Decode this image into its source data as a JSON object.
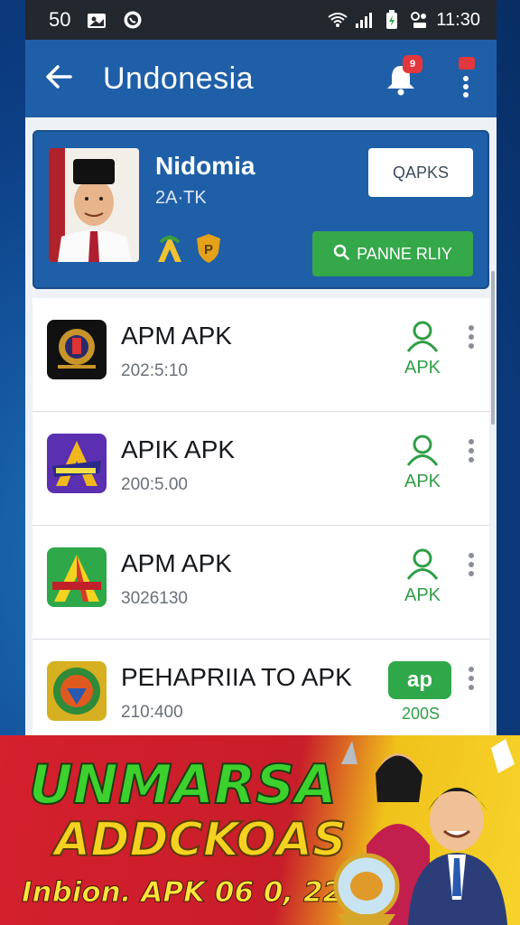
{
  "status_bar": {
    "left_text": "50",
    "time": "11:30",
    "icons": [
      "gallery-icon",
      "whatsapp-icon",
      "wifi-icon",
      "signal-icon",
      "battery-icon",
      "alarm-icon"
    ]
  },
  "app_bar": {
    "title": "Undonesia",
    "bell_badge": "9"
  },
  "profile": {
    "name": "Nidomia",
    "subtitle": "2A·TK",
    "qapks_button": "QAPKS",
    "primary_button": "PANNE RLIY"
  },
  "apps": [
    {
      "name": "APM APK",
      "date": "202:5:10",
      "action": "APK"
    },
    {
      "name": "APIK APK",
      "date": "200:5.00",
      "action": "APK"
    },
    {
      "name": "APM APK",
      "date": "3026130",
      "action": "APK"
    },
    {
      "name": "PEHAPRIIA TO APK",
      "date": "210:400",
      "action_badge": "ap",
      "action": "200S"
    }
  ],
  "banner": {
    "line1": "UNMARSA",
    "line2": "ADDCKOAS",
    "line3": "Inbion. APK 06 0, 220P!!"
  },
  "colors": {
    "primary": "#1f5fa8",
    "accent_green": "#35a84a",
    "badge_red": "#e2373c",
    "banner_red": "#d5202e",
    "banner_yellow": "#f0c21a"
  }
}
